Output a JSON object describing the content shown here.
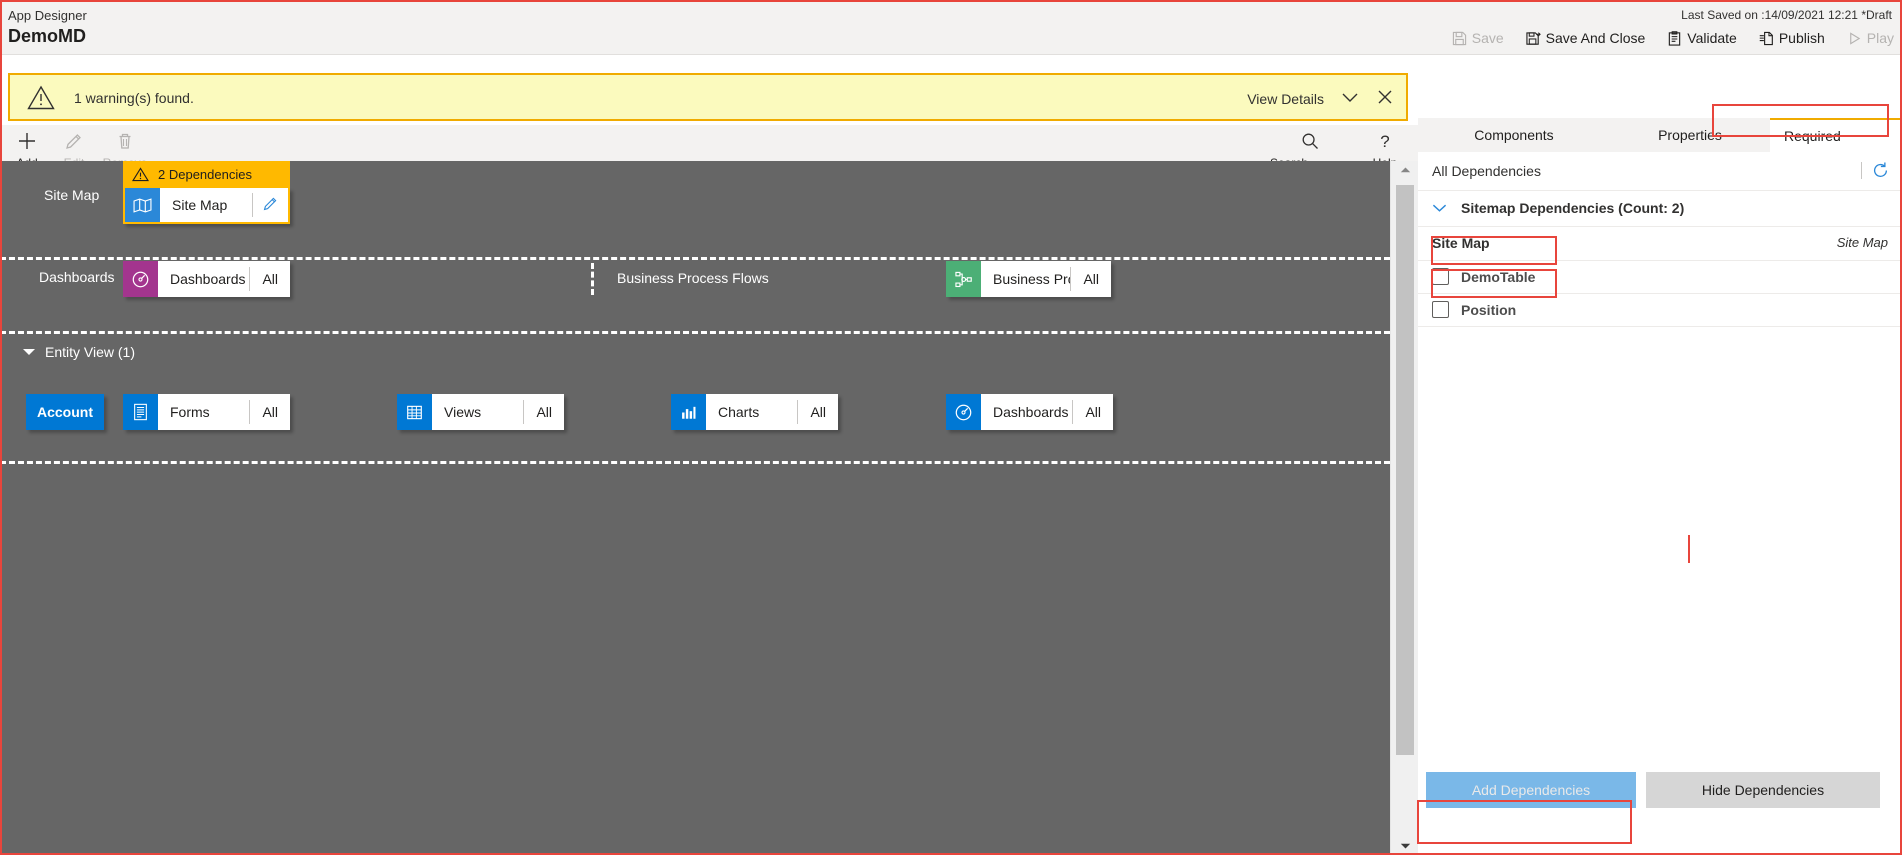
{
  "header": {
    "app_label": "App Designer",
    "app_title": "DemoMD",
    "last_saved": "Last Saved on :14/09/2021 12:21 *Draft",
    "commands": [
      {
        "label": "Save",
        "icon": "save-icon",
        "disabled": true
      },
      {
        "label": "Save And Close",
        "icon": "save-and-close-icon",
        "disabled": false
      },
      {
        "label": "Validate",
        "icon": "validate-clipboard-icon",
        "disabled": false
      },
      {
        "label": "Publish",
        "icon": "publish-icon",
        "disabled": false
      },
      {
        "label": "Play",
        "icon": "play-icon",
        "disabled": true
      }
    ]
  },
  "warning_bar": {
    "message": "1 warning(s) found.",
    "view_details": "View Details",
    "icon": "warning-triangle-icon",
    "border_color": "#f0ab00",
    "background_color": "#fbfabe"
  },
  "command_bar": {
    "items": [
      {
        "label": "Add",
        "icon": "plus-icon",
        "disabled": false
      },
      {
        "label": "Edit",
        "icon": "pencil-icon",
        "disabled": true
      },
      {
        "label": "Remove",
        "icon": "trash-icon",
        "disabled": true
      }
    ],
    "right_items": [
      {
        "label": "Search Canvas",
        "icon": "search-icon"
      },
      {
        "label": "Help",
        "icon": "question-mark-icon"
      }
    ]
  },
  "canvas": {
    "sitemap_section": {
      "row_label": "Site Map",
      "dependency_banner": "2 Dependencies",
      "dependency_icon": "warning-triangle-icon",
      "tile": {
        "name": "Site Map",
        "icon": "sitemap-map-icon",
        "icon_color": "#2b88d8",
        "edit_icon": "pencil-icon"
      }
    },
    "dashboards_section": {
      "row_label": "Dashboards",
      "tile": {
        "name": "Dashboards",
        "count": "All",
        "icon": "dashboard-gauge-icon",
        "icon_color": "#a3358e"
      }
    },
    "bpf_section": {
      "row_label": "Business Process Flows",
      "tile": {
        "name": "Business Proces...",
        "count": "All",
        "icon": "process-flow-icon",
        "icon_color": "#4caf76"
      }
    },
    "entity_view": {
      "header": "Entity View (1)",
      "entity": "Account",
      "tiles": [
        {
          "name": "Forms",
          "count": "All",
          "icon": "form-icon",
          "icon_color": "#0078d4"
        },
        {
          "name": "Views",
          "count": "All",
          "icon": "grid-icon",
          "icon_color": "#0078d4"
        },
        {
          "name": "Charts",
          "count": "All",
          "icon": "bar-chart-icon",
          "icon_color": "#0078d4"
        },
        {
          "name": "Dashboards",
          "count": "All",
          "icon": "dashboard-gauge-icon",
          "icon_color": "#0078d4"
        }
      ]
    }
  },
  "right_panel": {
    "tabs": [
      {
        "label": "Components",
        "selected": false
      },
      {
        "label": "Properties",
        "selected": false
      },
      {
        "label": "Required",
        "selected": true
      }
    ],
    "all_dependencies_label": "All Dependencies",
    "refresh_icon": "refresh-icon",
    "group": {
      "label": "Sitemap Dependencies (Count: 2)",
      "chevron": "chevron-down-icon"
    },
    "table_header": {
      "left": "Site Map",
      "right": "Site Map"
    },
    "rows": [
      {
        "name": "DemoTable",
        "checked": false
      },
      {
        "name": "Position",
        "checked": false
      }
    ],
    "footer": {
      "add_label": "Add Dependencies",
      "add_disabled": true,
      "hide_label": "Hide Dependencies"
    }
  },
  "highlights": {
    "color": "#e8453c"
  }
}
